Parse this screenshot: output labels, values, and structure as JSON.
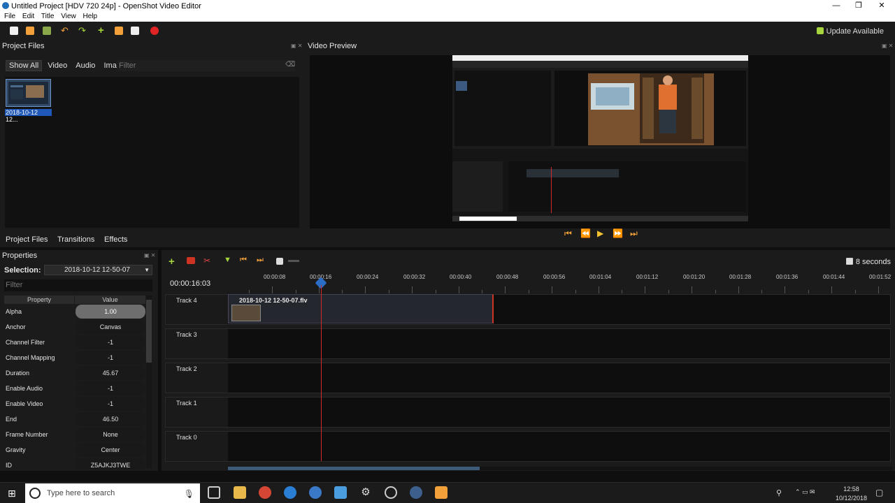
{
  "window": {
    "title": "Untitled Project [HDV 720 24p] - OpenShot Video Editor",
    "controls": [
      "—",
      "❐",
      "✕"
    ]
  },
  "menu": [
    "File",
    "Edit",
    "Title",
    "View",
    "Help"
  ],
  "toolbar": {
    "update_label": "Update Available",
    "colors": {
      "new": "#f0f0f0",
      "open": "#f2a13a",
      "save": "#8aa84a",
      "undo": "#f2a13a",
      "redo": "#a6d43c",
      "import": "#a6d43c",
      "profile": "#f2a13a",
      "fullscreen": "#eeeeee",
      "export": "#e02424"
    }
  },
  "project_files": {
    "header": "Project Files",
    "tabs": [
      "Show All",
      "Video",
      "Audio",
      "Image"
    ],
    "filter_placeholder": "Filter",
    "item_label": "2018-10-12 12..."
  },
  "bottom_tabs": [
    "Project Files",
    "Transitions",
    "Effects"
  ],
  "video_preview": {
    "header": "Video Preview"
  },
  "properties": {
    "header": "Properties",
    "selection_label": "Selection:",
    "selection_value": "2018-10-12 12-50-07",
    "filter_placeholder": "Filter",
    "col_property": "Property",
    "col_value": "Value",
    "rows": [
      {
        "name": "Alpha",
        "value": "1.00"
      },
      {
        "name": "Anchor",
        "value": "Canvas"
      },
      {
        "name": "Channel Filter",
        "value": "-1"
      },
      {
        "name": "Channel Mapping",
        "value": "-1"
      },
      {
        "name": "Duration",
        "value": "45.67"
      },
      {
        "name": "Enable Audio",
        "value": "-1"
      },
      {
        "name": "Enable Video",
        "value": "-1"
      },
      {
        "name": "End",
        "value": "46.50"
      },
      {
        "name": "Frame Number",
        "value": "None"
      },
      {
        "name": "Gravity",
        "value": "Center"
      },
      {
        "name": "ID",
        "value": "Z5AJKJ3TWE"
      }
    ]
  },
  "timeline": {
    "seconds_label": "8 seconds",
    "timecode": "00:00:16:03",
    "ruler": [
      "00:00:08",
      "00:00:16",
      "00:00:24",
      "00:00:32",
      "00:00:40",
      "00:00:48",
      "00:00:56",
      "00:01:04",
      "00:01:12",
      "00:01:20",
      "00:01:28",
      "00:01:36",
      "00:01:44",
      "00:01:52"
    ],
    "tracks": [
      "Track 4",
      "Track 3",
      "Track 2",
      "Track 1",
      "Track 0"
    ],
    "clip_label": "2018-10-12 12-50-07.flv"
  },
  "taskbar": {
    "search_placeholder": "Type here to search",
    "time": "12:58",
    "date": "10/12/2018"
  }
}
